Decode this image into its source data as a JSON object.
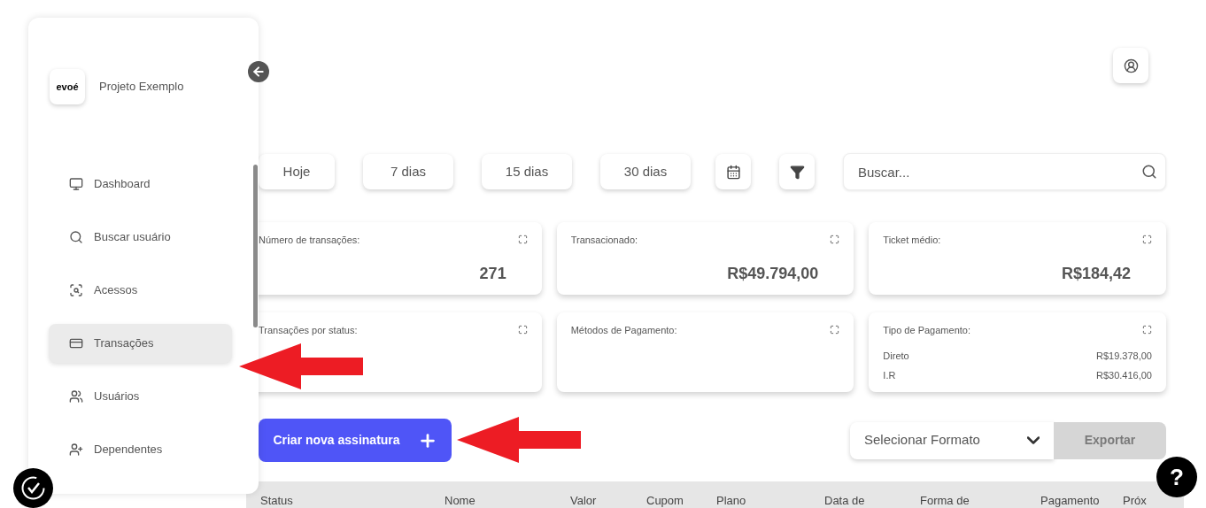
{
  "sidebar": {
    "logo": "evoé",
    "project": "Projeto Exemplo",
    "items": [
      {
        "label": "Dashboard",
        "selected": false
      },
      {
        "label": "Buscar usuário",
        "selected": false
      },
      {
        "label": "Acessos",
        "selected": false
      },
      {
        "label": "Transações",
        "selected": true
      },
      {
        "label": "Usuários",
        "selected": false
      },
      {
        "label": "Dependentes",
        "selected": false
      }
    ]
  },
  "filters": [
    {
      "label": "Hoje"
    },
    {
      "label": "7 dias"
    },
    {
      "label": "15 dias"
    },
    {
      "label": "30 dias"
    }
  ],
  "search": {
    "placeholder": "Buscar..."
  },
  "cards": [
    {
      "title": "Número de transações:",
      "value": "271"
    },
    {
      "title": "Transacionado:",
      "value": "R$49.794,00"
    },
    {
      "title": "Ticket médio:",
      "value": "R$184,42"
    },
    {
      "title": "Transações por status:"
    },
    {
      "title": "Métodos de Pagamento:"
    },
    {
      "title": "Tipo de Pagamento:",
      "rows": [
        {
          "label": "Direto",
          "value": "R$19.378,00"
        },
        {
          "label": "I.R",
          "value": "R$30.416,00"
        }
      ]
    }
  ],
  "create_button": "Criar nova assinatura",
  "format_select": "Selecionar Formato",
  "export_button": {
    "label": "Exportar",
    "disabled": true
  },
  "help": "?",
  "table": {
    "columns": [
      "Status",
      "Nome",
      "Valor",
      "Cupom",
      "Plano",
      "Data de",
      "Forma de",
      "Pagamento",
      "Próx"
    ]
  }
}
